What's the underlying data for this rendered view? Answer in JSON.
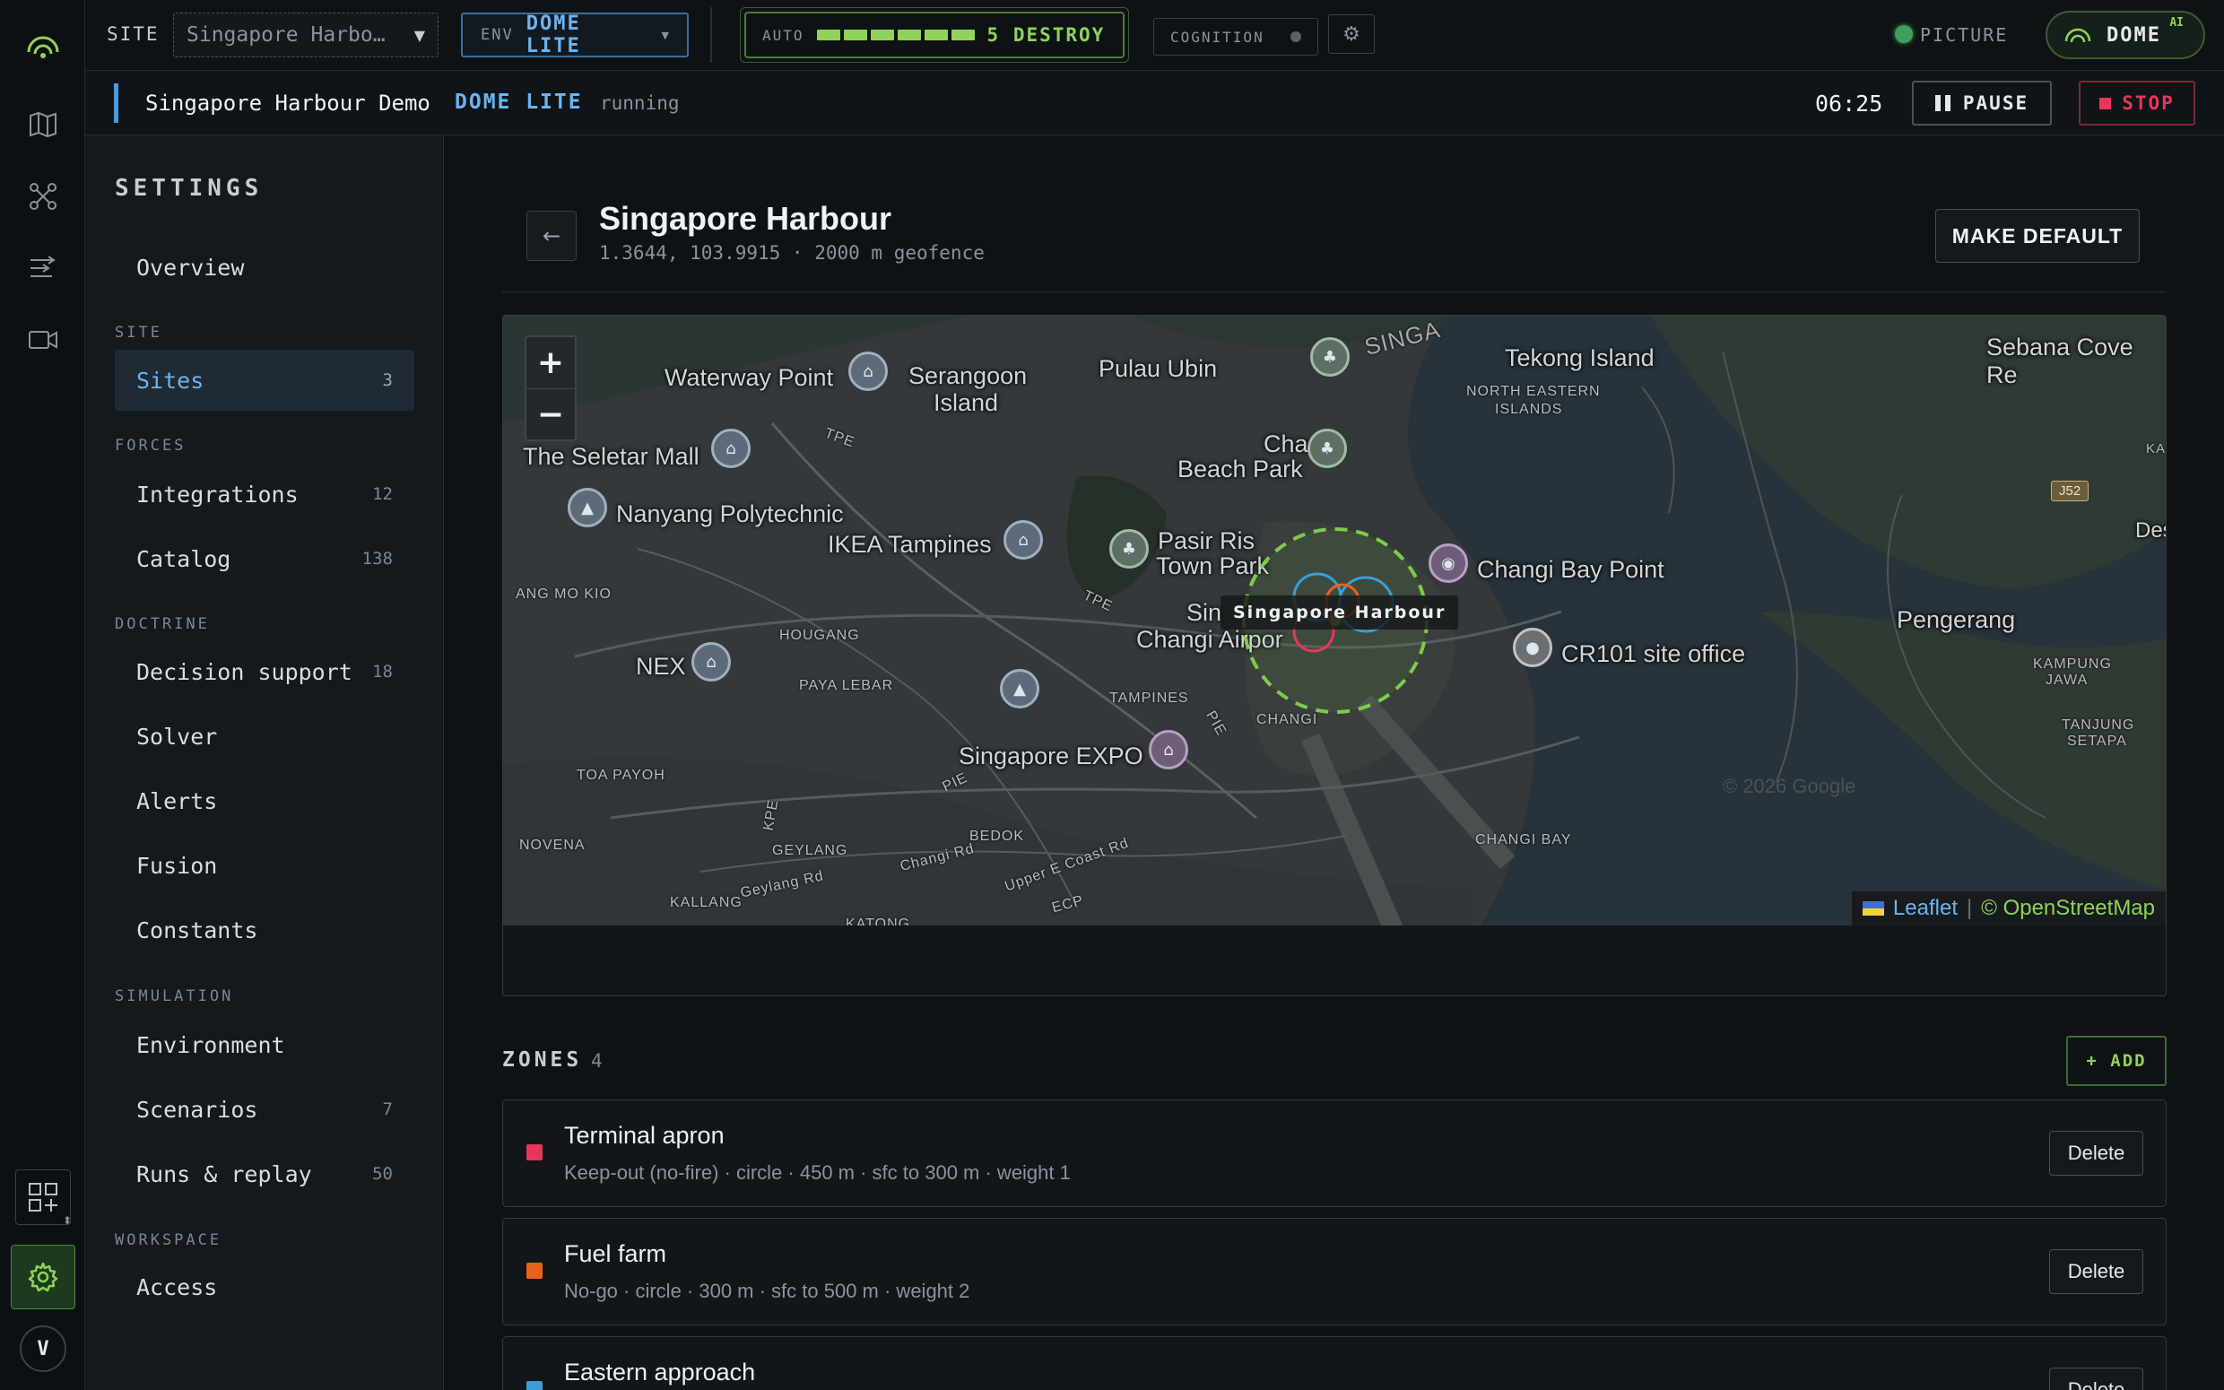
{
  "topbar": {
    "site_label": "SITE",
    "site_value": "Singapore Harbo…",
    "env_label": "ENV",
    "env_value": "DOME LITE",
    "auto_label": "AUTO",
    "auto_value": "5 DESTROY",
    "auto_level": 5,
    "cognition_label": "COGNITION",
    "picture_label": "PICTURE",
    "brand": "DOME",
    "brand_sup": "AI"
  },
  "subbar": {
    "run_name": "Singapore Harbour Demo",
    "env": "DOME LITE",
    "status": "running",
    "clock": "06:25",
    "pause_label": "PAUSE",
    "stop_label": "STOP"
  },
  "rail": {
    "avatar": "V"
  },
  "sidebar": {
    "title": "SETTINGS",
    "overview": "Overview",
    "sections": {
      "site": "SITE",
      "forces": "FORCES",
      "doctrine": "DOCTRINE",
      "simulation": "SIMULATION",
      "workspace": "WORKSPACE"
    },
    "items": [
      {
        "label": "Sites",
        "count": "3"
      },
      {
        "label": "Integrations",
        "count": "12"
      },
      {
        "label": "Catalog",
        "count": "138"
      },
      {
        "label": "Decision support",
        "count": "18"
      },
      {
        "label": "Solver",
        "count": ""
      },
      {
        "label": "Alerts",
        "count": ""
      },
      {
        "label": "Fusion",
        "count": ""
      },
      {
        "label": "Constants",
        "count": ""
      },
      {
        "label": "Environment",
        "count": ""
      },
      {
        "label": "Scenarios",
        "count": "7"
      },
      {
        "label": "Runs & replay",
        "count": "50"
      },
      {
        "label": "Access",
        "count": ""
      }
    ]
  },
  "site": {
    "title": "Singapore Harbour",
    "coords": "1.3644, 103.9915 · 2000 m geofence",
    "make_default": "MAKE DEFAULT"
  },
  "map": {
    "marker_label": "Singapore Harbour",
    "zoom_in": "+",
    "zoom_out": "−",
    "attribution_leaflet": "Leaflet",
    "attribution_sep": "|",
    "attribution_osm": "© OpenStreetMap",
    "places": {
      "waterway_point": "Waterway Point",
      "serangoon": "Serangoon",
      "serangoon2": "Island",
      "pulau_ubin": "Pulau Ubin",
      "singa": "SINGA",
      "tekong": "Tekong Island",
      "ne_islands1": "NORTH EASTERN",
      "ne_islands2": "ISLANDS",
      "sebana": "Sebana Cove Re",
      "seletar": "The Seletar Mall",
      "tpe1": "TPE",
      "changi_beach1": "Changi",
      "changi_beach2": "Beach Park",
      "nanyang": "Nanyang Polytechnic",
      "ikea": "IKEA Tampines",
      "pasir1": "Pasir Ris",
      "pasir2": "Town Park",
      "changi_bay": "Changi Bay Point",
      "angmokio": "ANG MO KIO",
      "tpe2": "TPE",
      "sin": "Sin",
      "changi_airport": "Changi Airpor",
      "hougang": "HOUGANG",
      "pengerang": "Pengerang",
      "cr101": "CR101 site office",
      "nex": "NEX",
      "paya_lebar": "PAYA LEBAR",
      "tampines": "TAMPINES",
      "changi": "CHANGI",
      "kampung1": "KAMPUNG",
      "kampung2": "JAWA",
      "tanjung1": "TANJUNG",
      "tanjung2": "SETAPA",
      "toa_payoh": "TOA PAYOH",
      "expo": "Singapore EXPO",
      "pie": "PIE",
      "pie2": "PIE",
      "kpe": "KPE",
      "bedok": "BEDOK",
      "novena": "NOVENA",
      "geylang": "GEYLANG",
      "changi_rd": "Changi Rd",
      "geylang_rd": "Geylang Rd",
      "upper_east": "Upper E Coast Rd",
      "ecp": "ECP",
      "kallang": "KALLANG",
      "katong": "KATONG",
      "changi_bay2": "CHANGI BAY",
      "j52": "J52",
      "ka": "KA",
      "des": "Des",
      "watermark": "© 2026 Google"
    }
  },
  "zones": {
    "title": "ZONES",
    "count": "4",
    "add_label": "+ ADD",
    "delete_label": "Delete",
    "items": [
      {
        "name": "Terminal apron",
        "desc": "Keep-out (no-fire) · circle · 450 m · sfc to 300 m · weight 1",
        "color": "#e8365a"
      },
      {
        "name": "Fuel farm",
        "desc": "No-go · circle · 300 m · sfc to 500 m · weight 2",
        "color": "#e8621e"
      },
      {
        "name": "Eastern approach",
        "desc": "",
        "color": "#3a9fd6"
      }
    ]
  },
  "colors": {
    "accent_blue": "#6cb4f0",
    "accent_green": "#8fd35a",
    "stop_red": "#e8365a",
    "geofence": "#7ecb4a"
  }
}
